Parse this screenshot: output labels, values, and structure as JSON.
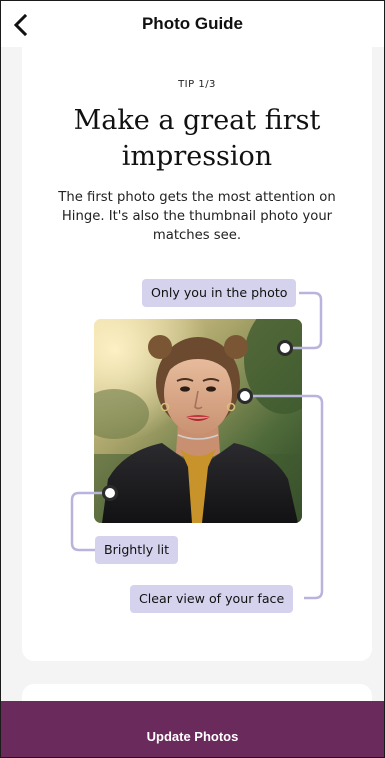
{
  "header": {
    "title": "Photo Guide",
    "back_icon": "chevron-left-icon"
  },
  "tip": {
    "counter": "TIP 1/3",
    "title": "Make a great first impression",
    "description": "The first photo gets the most attention on Hinge.  It's also the thumbnail photo your matches see."
  },
  "annotations": {
    "only_you": "Only you in the photo",
    "brightly_lit": "Brightly lit",
    "clear_view": "Clear view of your face"
  },
  "footer": {
    "update_label": "Update Photos"
  },
  "colors": {
    "accent": "#6a2a5b",
    "chip_bg": "#d5d2ed",
    "connector": "#b9b4de"
  }
}
